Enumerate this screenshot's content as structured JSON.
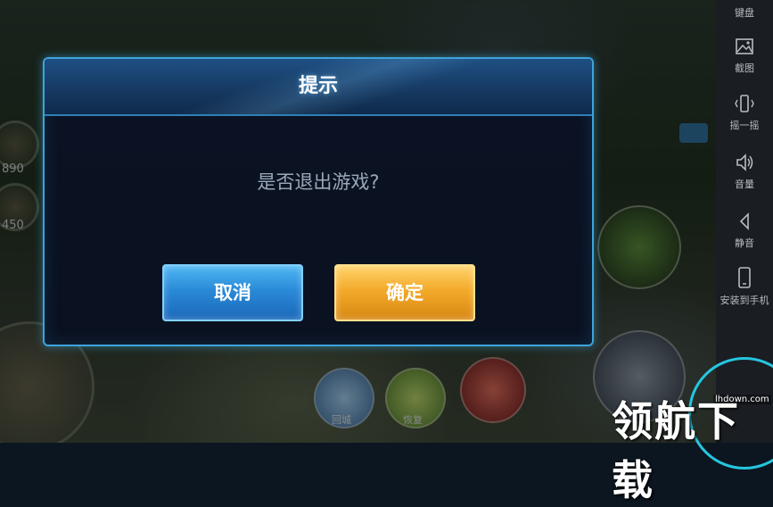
{
  "background": {
    "left_stats": [
      "890",
      "450"
    ],
    "skills": [
      "回城",
      "恢复"
    ]
  },
  "dialog": {
    "title": "提示",
    "message": "是否退出游戏?",
    "cancel_label": "取消",
    "confirm_label": "确定"
  },
  "toolbar": {
    "items": [
      {
        "label": "键盘",
        "icon": "keyboard-icon"
      },
      {
        "label": "截图",
        "icon": "screenshot-icon"
      },
      {
        "label": "摇一摇",
        "icon": "shake-icon"
      },
      {
        "label": "音量",
        "icon": "volume-icon"
      },
      {
        "label": "静音",
        "icon": "mute-icon"
      },
      {
        "label": "安装到手机",
        "icon": "phone-icon"
      }
    ]
  },
  "watermark": {
    "text": "领航下载",
    "url": "lhdown.com"
  },
  "colors": {
    "dialog_border": "#3fa3d8",
    "cancel_button": "#2a8ad8",
    "confirm_button": "#f3aa2a",
    "watermark_ring": "#25c6e0"
  }
}
